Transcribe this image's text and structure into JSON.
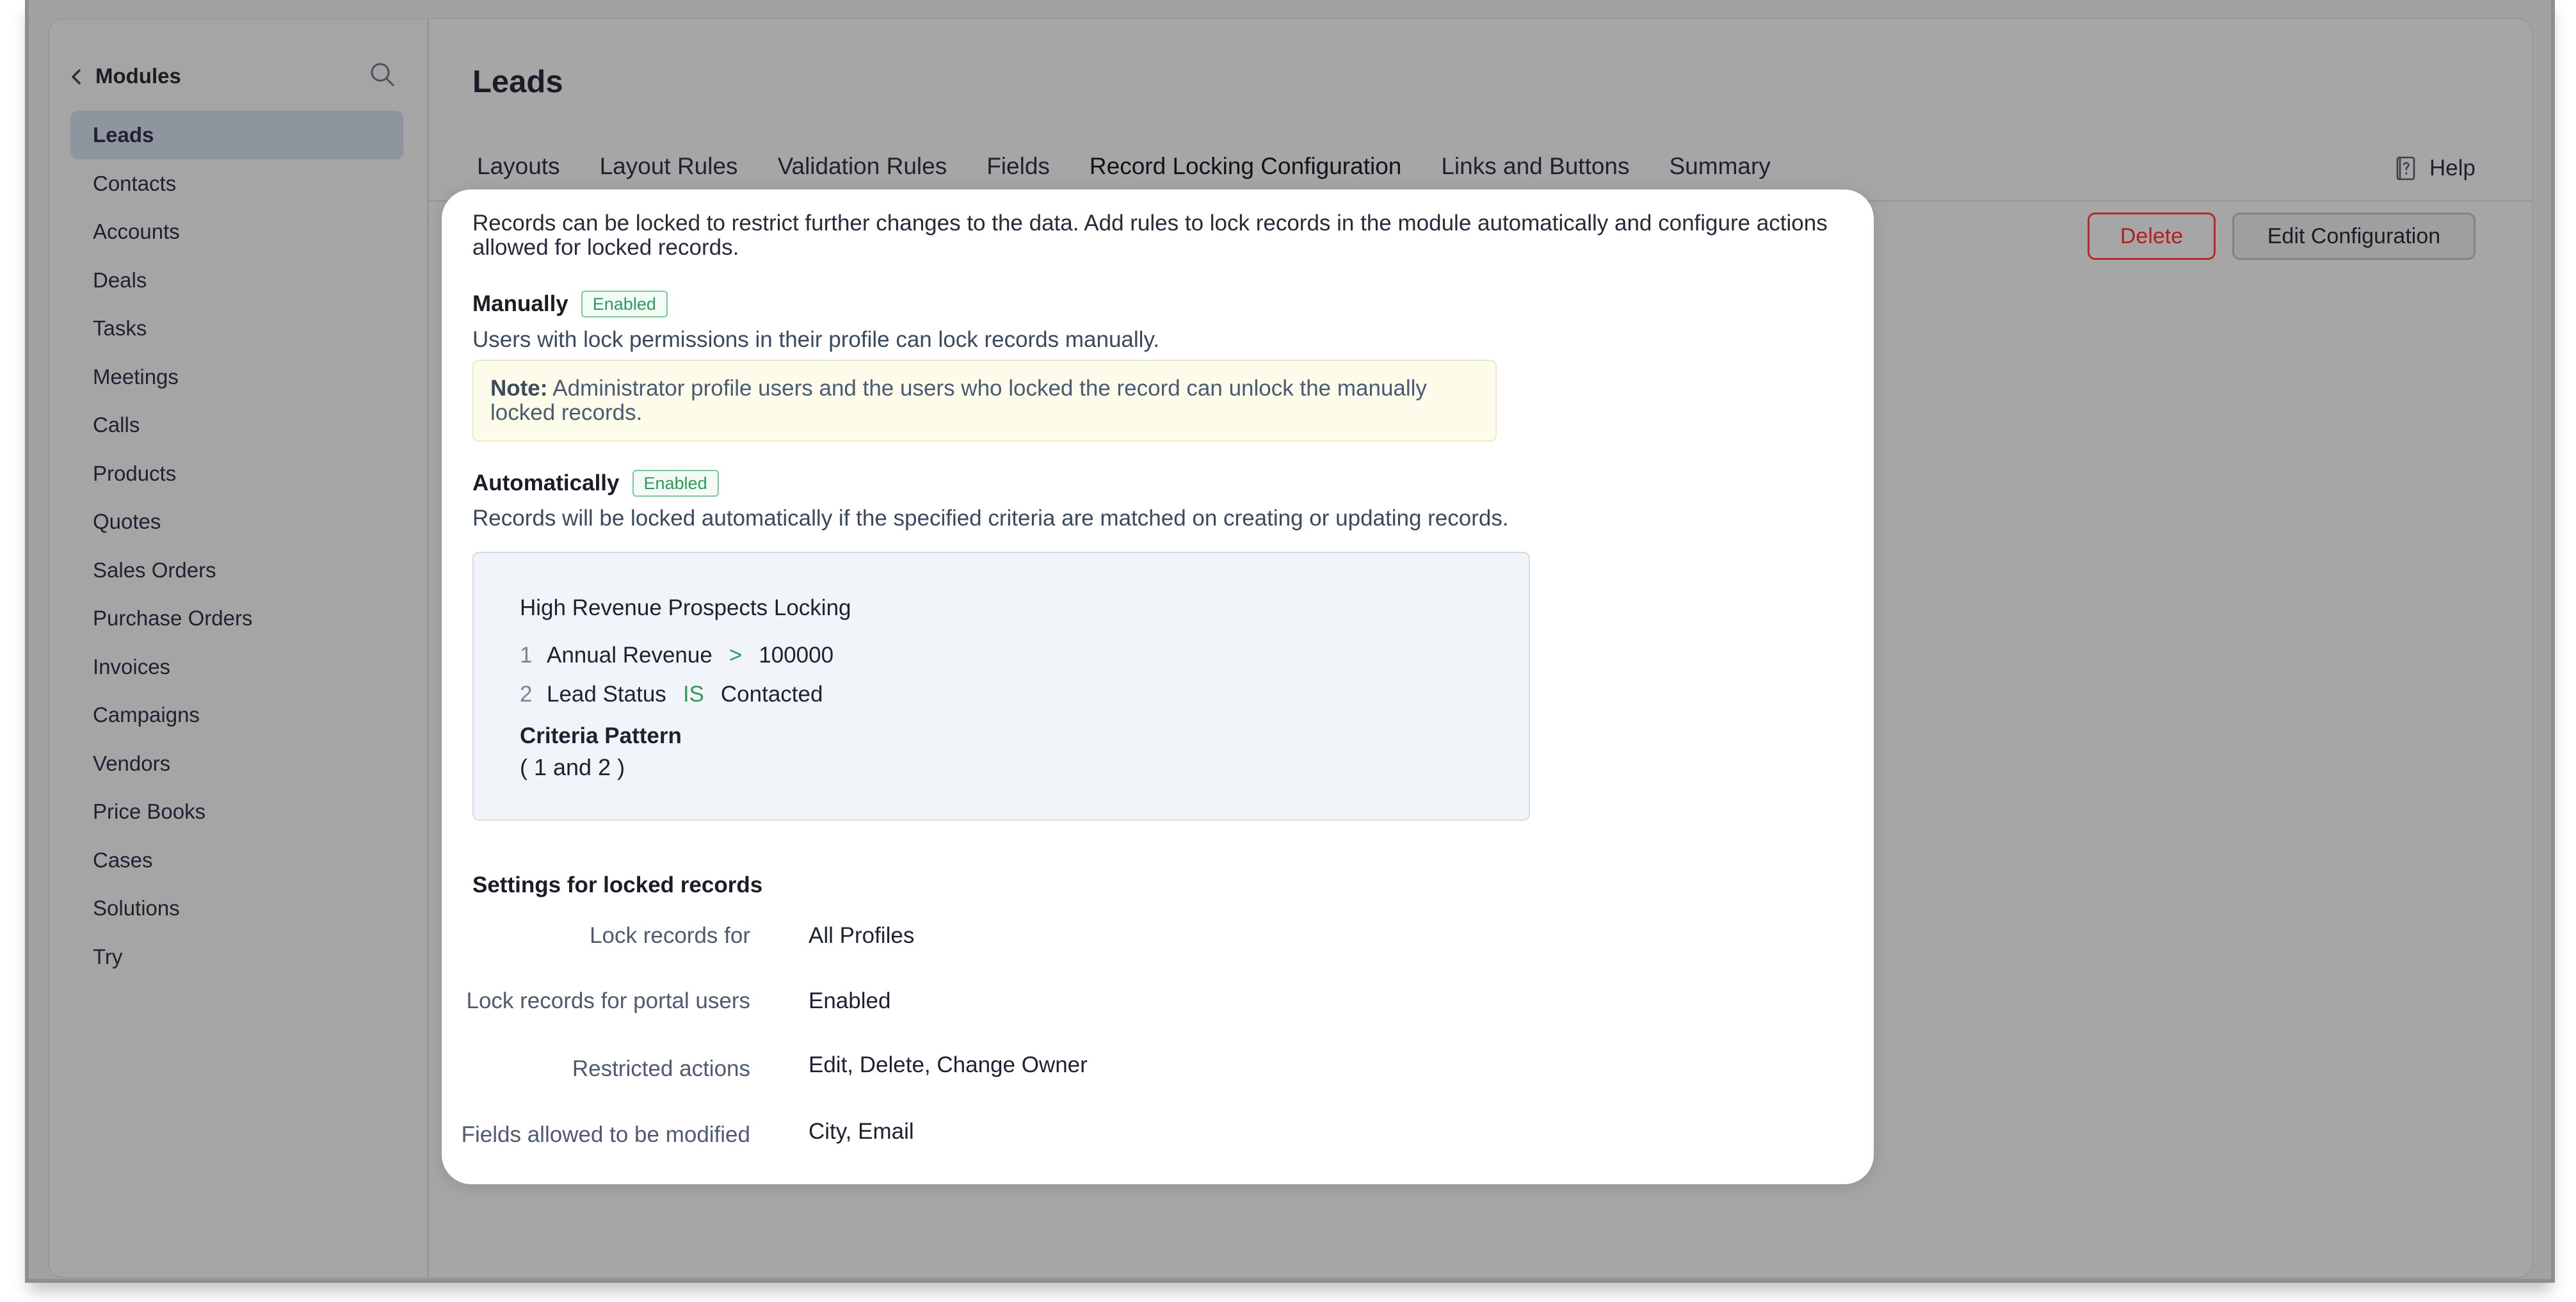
{
  "sidebar": {
    "title": "Modules",
    "items": [
      {
        "label": "Leads",
        "active": true
      },
      {
        "label": "Contacts"
      },
      {
        "label": "Accounts"
      },
      {
        "label": "Deals"
      },
      {
        "label": "Tasks"
      },
      {
        "label": "Meetings"
      },
      {
        "label": "Calls"
      },
      {
        "label": "Products"
      },
      {
        "label": "Quotes"
      },
      {
        "label": "Sales Orders"
      },
      {
        "label": "Purchase Orders"
      },
      {
        "label": "Invoices"
      },
      {
        "label": "Campaigns"
      },
      {
        "label": "Vendors"
      },
      {
        "label": "Price Books"
      },
      {
        "label": "Cases"
      },
      {
        "label": "Solutions"
      },
      {
        "label": "Try"
      }
    ]
  },
  "header": {
    "title": "Leads",
    "help_label": "Help"
  },
  "tabs": [
    {
      "label": "Layouts"
    },
    {
      "label": "Layout Rules"
    },
    {
      "label": "Validation Rules"
    },
    {
      "label": "Fields"
    },
    {
      "label": "Record Locking Configuration",
      "active": true
    },
    {
      "label": "Links and Buttons"
    },
    {
      "label": "Summary"
    }
  ],
  "actions": {
    "delete_label": "Delete",
    "edit_label": "Edit Configuration"
  },
  "card": {
    "intro": "Records can be locked to restrict further changes to the data. Add rules to lock records in the module automatically and configure actions allowed for locked records.",
    "manual": {
      "title": "Manually",
      "badge": "Enabled",
      "description": "Users with lock permissions in their profile can lock records manually.",
      "note_label": "Note:",
      "note_text": " Administrator profile users and the users who locked the record can unlock the manually locked records."
    },
    "automatic": {
      "title": "Automatically",
      "badge": "Enabled",
      "description": "Records will be locked automatically if the specified criteria are matched on creating or updating records.",
      "rule_name": "High Revenue Prospects Locking",
      "criteria": [
        {
          "num": "1",
          "field": "Annual Revenue",
          "op": ">",
          "value": "100000"
        },
        {
          "num": "2",
          "field": "Lead Status",
          "op": "IS",
          "value": "Contacted"
        }
      ],
      "pattern_label": "Criteria Pattern",
      "pattern_value": "( 1 and 2 )"
    },
    "settings": {
      "title": "Settings for locked records",
      "rows": [
        {
          "label": "Lock records for",
          "value": "All Profiles"
        },
        {
          "label": "Lock records for portal users",
          "value": "Enabled"
        },
        {
          "label": "Restricted actions",
          "value": "Edit, Delete, Change Owner"
        },
        {
          "label": "Fields allowed to be modified",
          "value": "City, Email"
        }
      ]
    }
  },
  "colors": {
    "accent": "#1f4fa8",
    "badge_green": "#2e9a57",
    "delete_red": "#b32020"
  }
}
